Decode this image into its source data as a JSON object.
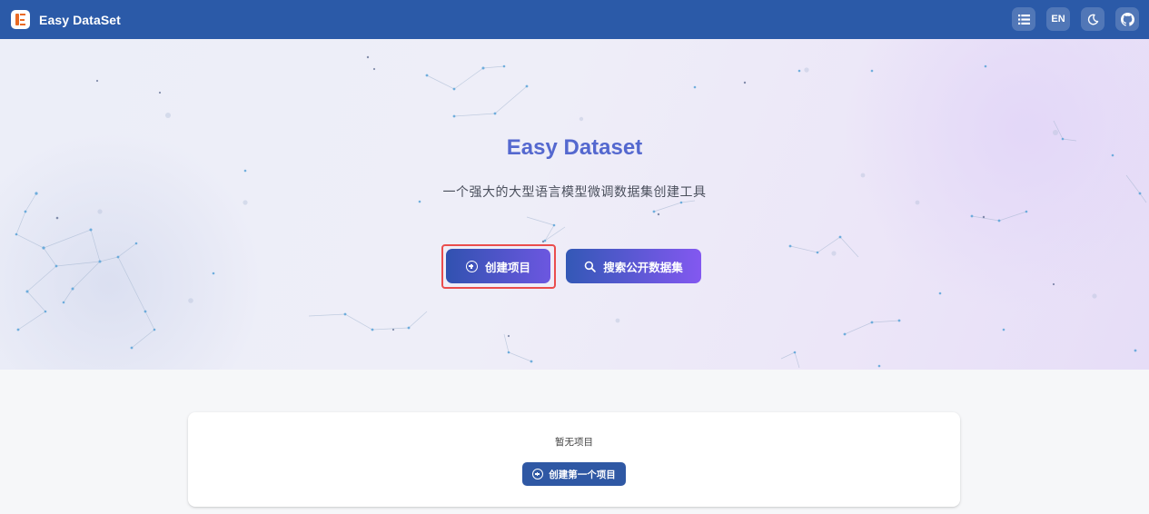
{
  "app": {
    "title": "Easy DataSet"
  },
  "topbar": {
    "actions": [
      {
        "icon": "list-icon"
      },
      {
        "label": "EN"
      },
      {
        "icon": "moon-icon"
      },
      {
        "icon": "github-icon"
      }
    ]
  },
  "hero": {
    "title": "Easy Dataset",
    "subtitle": "一个强大的大型语言模型微调数据集创建工具",
    "create_button_label": "创建项目",
    "search_button_label": "搜索公开数据集"
  },
  "projects": {
    "empty_text": "暂无项目",
    "create_first_label": "创建第一个项目"
  },
  "colors": {
    "topbar": "#2b5aa8",
    "title": "#5468cf",
    "highlight": "#ea4d4d"
  }
}
